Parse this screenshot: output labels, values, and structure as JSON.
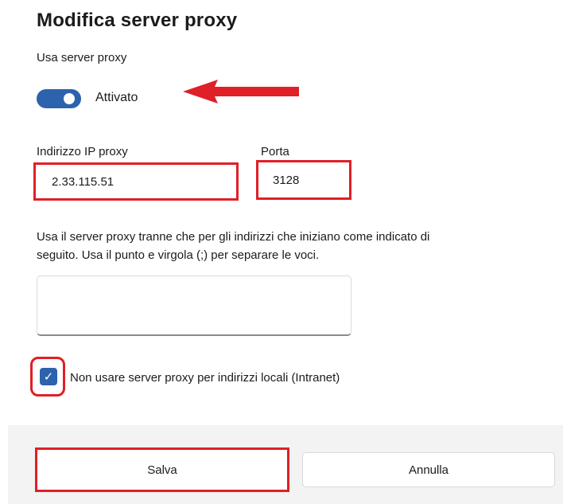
{
  "dialog": {
    "title": "Modifica server proxy",
    "use_proxy_label": "Usa server proxy",
    "toggle_state": "Attivato",
    "ip_label": "Indirizzo IP proxy",
    "ip_value": "2.33.115.51",
    "port_label": "Porta",
    "port_value": "3128",
    "exceptions_description": "Usa il server proxy tranne che per gli indirizzi che iniziano come indicato di\nseguito. Usa il punto e virgola (;) per separare le voci.",
    "exceptions_value": "",
    "bypass_local_label": "Non usare server proxy per indirizzi locali (Intranet)",
    "bypass_local_checked": true,
    "toggle_on": true
  },
  "footer": {
    "save_label": "Salva",
    "cancel_label": "Annulla"
  },
  "colors": {
    "accent": "#2d62ac",
    "highlight": "#e01f26"
  }
}
